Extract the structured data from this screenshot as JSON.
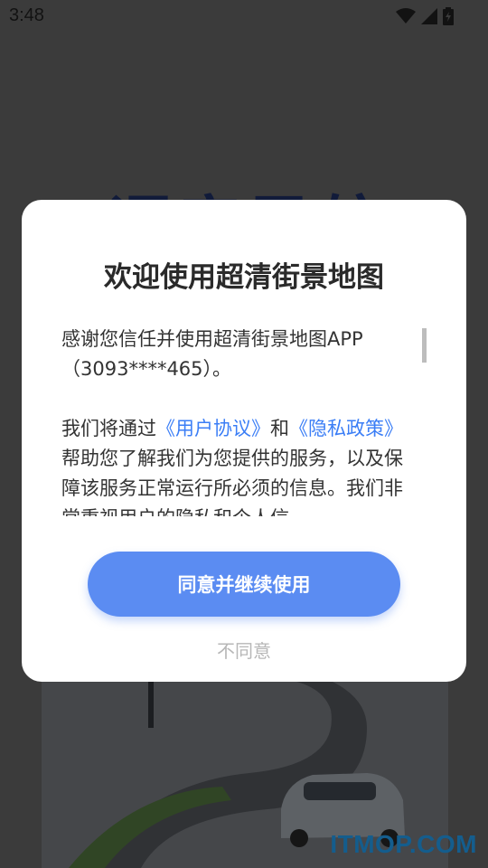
{
  "status_bar": {
    "time": "3:48",
    "icons": [
      "wifi-icon",
      "cell-signal-icon",
      "battery-icon"
    ]
  },
  "background": {
    "title": "语音导航",
    "watermark": "ITMOP.COM"
  },
  "dialog": {
    "title": "欢迎使用超清街景地图",
    "para1": "感谢您信任并使用超清街景地图APP（3093****465）。",
    "para2_prefix": "我们将通过",
    "user_agreement_link": "《用户协议》",
    "para2_and": "和",
    "privacy_policy_link": "《隐私政策》",
    "para2_suffix": "帮助您了解我们为您提供的服务，以及保障该服务正常运行所必须的信息。我们非常重视用户的隐私和个人信",
    "agree_button": "同意并继续使用",
    "disagree_button": "不同意"
  },
  "colors": {
    "accent": "#5b8cf2",
    "link": "#3b7ef6",
    "watermark": "#1f8fd9"
  }
}
